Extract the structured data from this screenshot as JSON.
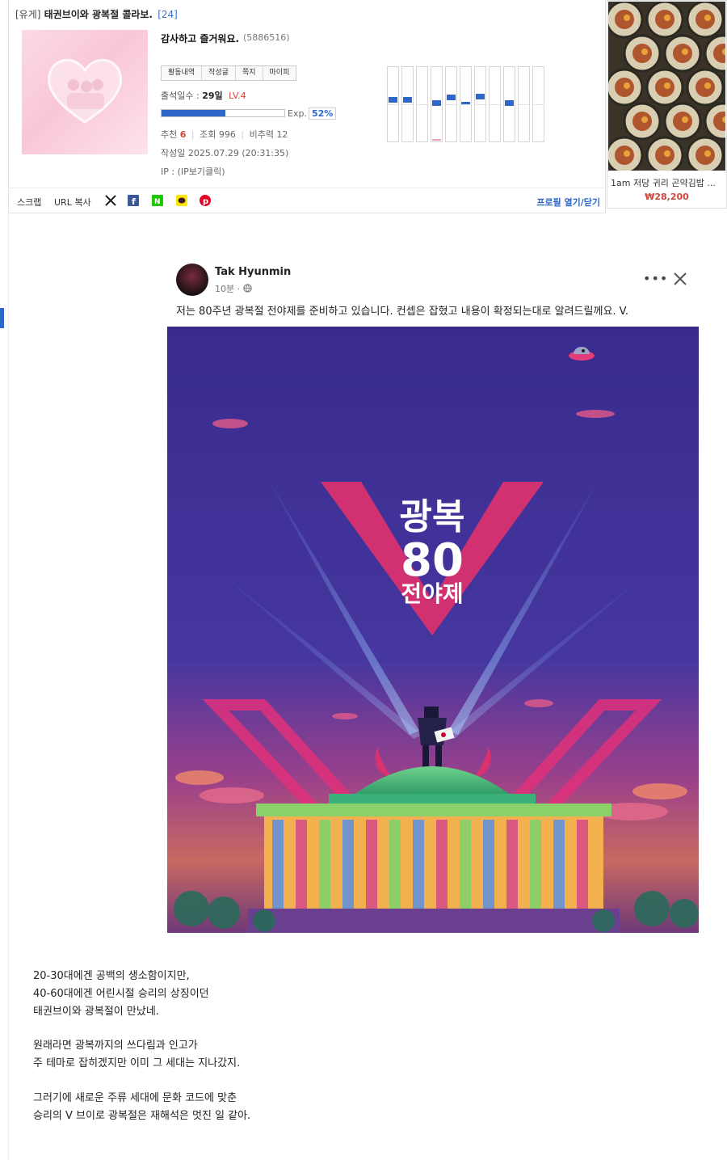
{
  "post": {
    "category": "[유게]",
    "title": "태권브이와 광복절 콜라보.",
    "comment_count": "[24]"
  },
  "profile": {
    "nickname": "감사하고 즐거워요.",
    "member_id": "(5886516)",
    "tabs": [
      "활동내역",
      "작성글",
      "쪽지",
      "마이피"
    ],
    "attend_label": "출석일수 :",
    "attend_days": "29일",
    "level": "LV.4",
    "exp_label": "Exp.",
    "exp_percent": "52%",
    "exp_fraction": 0.52,
    "recommend_label": "추천",
    "recommend_count": "6",
    "views_label": "조회 996",
    "unrec_label": "비추력 12",
    "written": "작성일 2025.07.29 (20:31:35)",
    "ip": "IP : (IP보기클릭)",
    "activity_graph": [
      {
        "level": 0.43
      },
      {
        "level": 0.43
      },
      {
        "level": 0.0
      },
      {
        "level": 0.47,
        "low": 0.02
      },
      {
        "level": 0.4
      },
      {
        "level": 0.49
      },
      {
        "level": 0.39
      },
      {
        "level": 0.0
      },
      {
        "level": 0.47
      },
      {
        "level": 0.0
      },
      {
        "level": 0.0
      }
    ]
  },
  "actions": {
    "scrap": "스크랩",
    "url_copy": "URL 복사",
    "share_icons": [
      "x-icon",
      "facebook-icon",
      "naver-icon",
      "kakao-icon",
      "pinterest-icon"
    ],
    "profile_toggle": "프로필 열기/닫기"
  },
  "ad": {
    "title": "1am 저당 귀리 곤약김밥 ...",
    "price": "₩28,200"
  },
  "facebook": {
    "author": "Tak Hyunmin",
    "time": "10분 ·",
    "text": "저는 80주년 광복절 전야제를 준비하고 있습니다. 컨셉은 잡혔고 내용이 확정되는대로 알려드릴께요. V.",
    "more": "•••"
  },
  "poster": {
    "line1": "광복",
    "line2": "80",
    "line3": "전야제"
  },
  "body": {
    "p1": [
      "20-30대에겐 공백의 생소함이지만,",
      "40-60대에겐 어린시절 승리의 상징이던",
      "태권브이와 광복절이 만났네."
    ],
    "p2": [
      "원래라면 광복까지의 쓰다림과 인고가",
      "주 테마로 잡히겠지만 이미 그 세대는 지나갔지."
    ],
    "p3": [
      "그러기에 새로운 주류 세대에 문화 코드에 맞춘",
      "승리의 V 브이로 광복절은 재해석은 멋진 일 같아."
    ]
  },
  "colors": {
    "accent": "#2c67c9",
    "red": "#d0453a",
    "poster_bg": "#3f2f8f",
    "v_pink": "#e0307a"
  }
}
